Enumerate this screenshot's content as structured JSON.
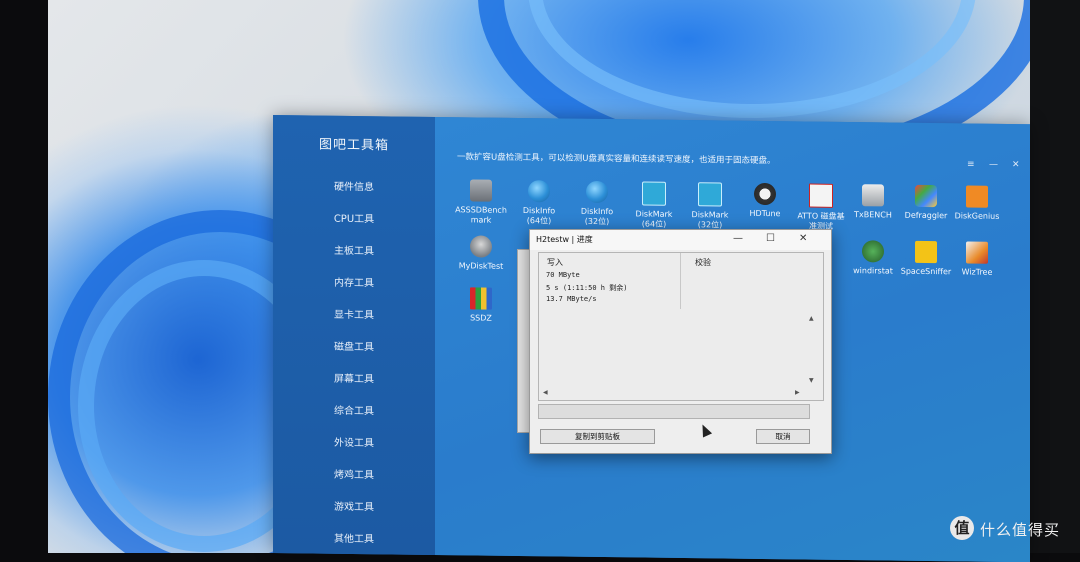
{
  "app": {
    "title": "图吧工具箱",
    "banner": "一款扩容U盘检测工具，可以检测U盘真实容量和连续读写速度，也适用于固态硬盘。",
    "sidebar": [
      "硬件信息",
      "CPU工具",
      "主板工具",
      "内存工具",
      "显卡工具",
      "磁盘工具",
      "屏幕工具",
      "综合工具",
      "外设工具",
      "烤鸡工具",
      "游戏工具",
      "其他工具"
    ],
    "window_controls": [
      "≡",
      "—",
      "✕"
    ]
  },
  "tools": {
    "row1": [
      {
        "label": "ASSSDBench\nmark",
        "icon": "disk-icon"
      },
      {
        "label": "DiskInfo\n(64位)",
        "icon": "globe-icon"
      },
      {
        "label": "DiskInfo\n(32位)",
        "icon": "globe-icon"
      },
      {
        "label": "DiskMark\n(64位)",
        "icon": "diskmark-icon"
      },
      {
        "label": "DiskMark\n(32位)",
        "icon": "diskmark-icon"
      },
      {
        "label": "HDTune",
        "icon": "hdtune-icon"
      },
      {
        "label": "ATTO 磁盘基\n准测试",
        "icon": "atto-icon"
      },
      {
        "label": "TxBENCH",
        "icon": "txbench-icon"
      },
      {
        "label": "Defraggler",
        "icon": "defraggler-icon"
      },
      {
        "label": "DiskGenius",
        "icon": "diskgenius-icon"
      }
    ],
    "row2": [
      {
        "label": "MyDiskTest",
        "icon": "mydisktest-icon"
      },
      {
        "label": "windirstat",
        "icon": "windirstat-icon"
      },
      {
        "label": "SpaceSniffer",
        "icon": "spacesniffer-icon"
      },
      {
        "label": "WizTree",
        "icon": "wiztree-icon"
      }
    ],
    "row3": [
      {
        "label": "SSDZ",
        "icon": "ssdz-icon"
      }
    ]
  },
  "dialog": {
    "title": "H2testw | 进度",
    "controls": [
      "—",
      "☐",
      "✕"
    ],
    "write_header": "写入",
    "verify_header": "校验",
    "log": [
      "70 MByte",
      "5 s (1:11:50 h 剩余)",
      "13.7 MByte/s"
    ],
    "copy_button": "复制到剪贴板",
    "cancel_button": "取消"
  },
  "watermark": {
    "icon_char": "值",
    "text": "什么值得买"
  }
}
